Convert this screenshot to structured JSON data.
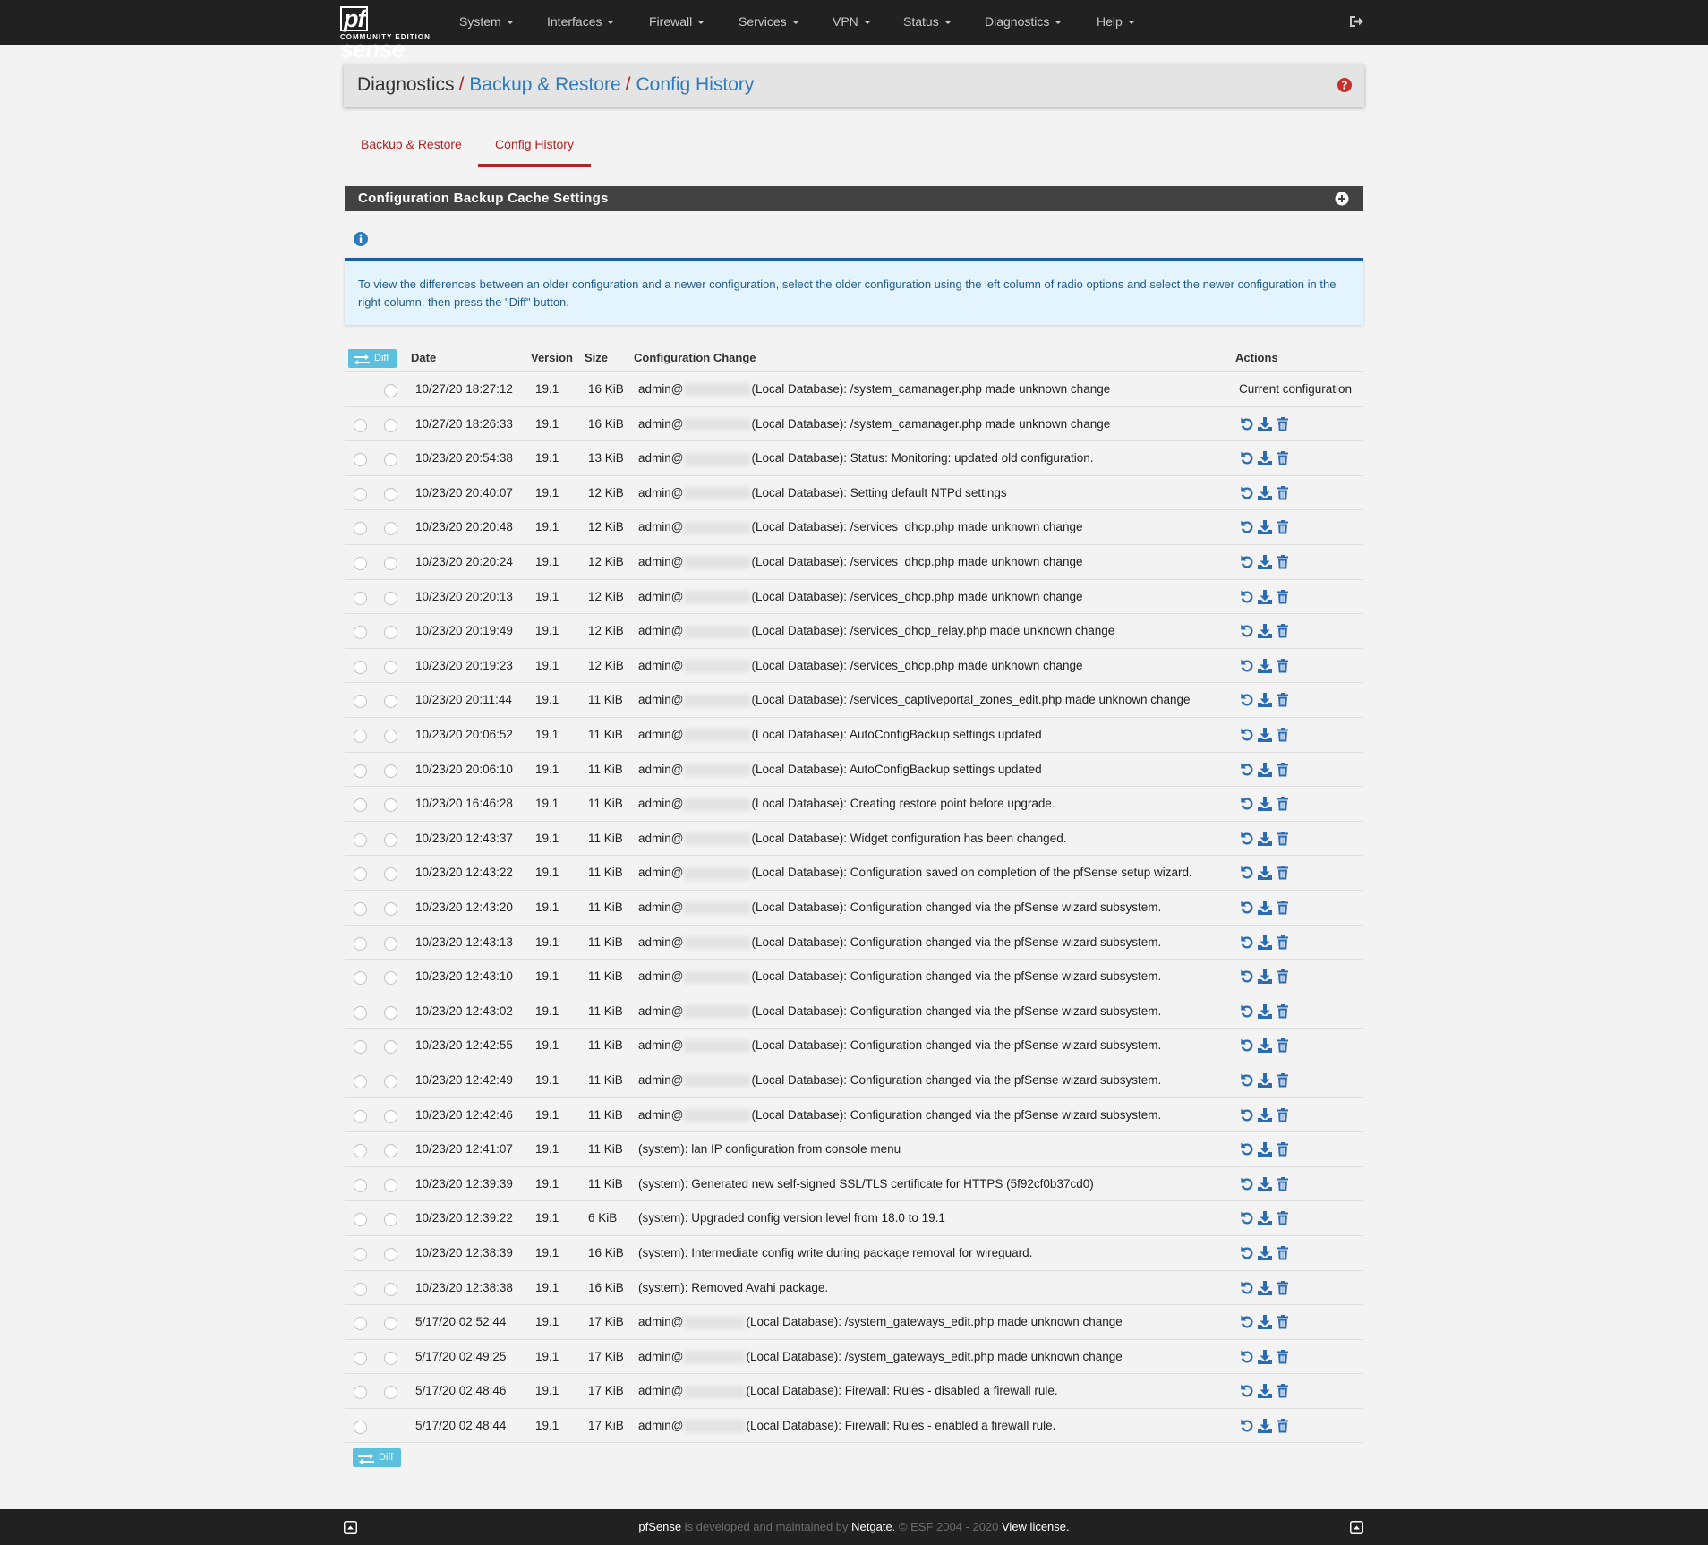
{
  "brand": {
    "name": "pfsense",
    "edition": "COMMUNITY EDITION"
  },
  "nav": {
    "items": [
      {
        "label": "System"
      },
      {
        "label": "Interfaces"
      },
      {
        "label": "Firewall"
      },
      {
        "label": "Services"
      },
      {
        "label": "VPN"
      },
      {
        "label": "Status"
      },
      {
        "label": "Diagnostics"
      },
      {
        "label": "Help"
      }
    ],
    "logout_icon": "sign-out-icon"
  },
  "breadcrumb": {
    "first": "Diagnostics",
    "separator": "/",
    "second": "Backup & Restore",
    "third": "Config History",
    "help_icon": "question-circle-icon"
  },
  "tabs": [
    {
      "label": "Backup & Restore",
      "active": false
    },
    {
      "label": "Config History",
      "active": true
    }
  ],
  "section": {
    "title": "Configuration Backup Cache Settings",
    "toggle_icon": "plus-circle-icon",
    "info_icon": "info-circle-icon"
  },
  "alert": {
    "text": "To view the differences between an older configuration and a newer configuration, select the older configuration using the left column of radio options and select the newer configuration in the right column, then press the \"Diff\" button."
  },
  "table": {
    "diff_label": "Diff",
    "headers": {
      "date": "Date",
      "version": "Version",
      "size": "Size",
      "change": "Configuration Change",
      "actions": "Actions"
    },
    "current_label": "Current configuration",
    "action_icons": [
      "undo-icon",
      "download-icon",
      "trash-icon"
    ],
    "rows": [
      {
        "date": "10/27/20 18:27:12",
        "version": "19.1",
        "size": "16 KiB",
        "user": "admin@",
        "change": "(Local Database): /system_camanager.php made unknown change",
        "current": true,
        "left_radio": false,
        "right_radio": true
      },
      {
        "date": "10/27/20 18:26:33",
        "version": "19.1",
        "size": "16 KiB",
        "user": "admin@",
        "change": "(Local Database): /system_camanager.php made unknown change",
        "current": false,
        "left_radio": true,
        "right_radio": true
      },
      {
        "date": "10/23/20 20:54:38",
        "version": "19.1",
        "size": "13 KiB",
        "user": "admin@",
        "change": "(Local Database): Status: Monitoring: updated old configuration.",
        "current": false,
        "left_radio": true,
        "right_radio": true
      },
      {
        "date": "10/23/20 20:40:07",
        "version": "19.1",
        "size": "12 KiB",
        "user": "admin@",
        "change": "(Local Database): Setting default NTPd settings",
        "current": false,
        "left_radio": true,
        "right_radio": true
      },
      {
        "date": "10/23/20 20:20:48",
        "version": "19.1",
        "size": "12 KiB",
        "user": "admin@",
        "change": "(Local Database): /services_dhcp.php made unknown change",
        "current": false,
        "left_radio": true,
        "right_radio": true
      },
      {
        "date": "10/23/20 20:20:24",
        "version": "19.1",
        "size": "12 KiB",
        "user": "admin@",
        "change": "(Local Database): /services_dhcp.php made unknown change",
        "current": false,
        "left_radio": true,
        "right_radio": true
      },
      {
        "date": "10/23/20 20:20:13",
        "version": "19.1",
        "size": "12 KiB",
        "user": "admin@",
        "change": "(Local Database): /services_dhcp.php made unknown change",
        "current": false,
        "left_radio": true,
        "right_radio": true
      },
      {
        "date": "10/23/20 20:19:49",
        "version": "19.1",
        "size": "12 KiB",
        "user": "admin@",
        "change": "(Local Database): /services_dhcp_relay.php made unknown change",
        "current": false,
        "left_radio": true,
        "right_radio": true
      },
      {
        "date": "10/23/20 20:19:23",
        "version": "19.1",
        "size": "12 KiB",
        "user": "admin@",
        "change": "(Local Database): /services_dhcp.php made unknown change",
        "current": false,
        "left_radio": true,
        "right_radio": true
      },
      {
        "date": "10/23/20 20:11:44",
        "version": "19.1",
        "size": "11 KiB",
        "user": "admin@",
        "change": "(Local Database): /services_captiveportal_zones_edit.php made unknown change",
        "current": false,
        "left_radio": true,
        "right_radio": true
      },
      {
        "date": "10/23/20 20:06:52",
        "version": "19.1",
        "size": "11 KiB",
        "user": "admin@",
        "change": "(Local Database): AutoConfigBackup settings updated",
        "current": false,
        "left_radio": true,
        "right_radio": true
      },
      {
        "date": "10/23/20 20:06:10",
        "version": "19.1",
        "size": "11 KiB",
        "user": "admin@",
        "change": "(Local Database): AutoConfigBackup settings updated",
        "current": false,
        "left_radio": true,
        "right_radio": true
      },
      {
        "date": "10/23/20 16:46:28",
        "version": "19.1",
        "size": "11 KiB",
        "user": "admin@",
        "change": "(Local Database): Creating restore point before upgrade.",
        "current": false,
        "left_radio": true,
        "right_radio": true
      },
      {
        "date": "10/23/20 12:43:37",
        "version": "19.1",
        "size": "11 KiB",
        "user": "admin@",
        "change": "(Local Database): Widget configuration has been changed.",
        "current": false,
        "left_radio": true,
        "right_radio": true
      },
      {
        "date": "10/23/20 12:43:22",
        "version": "19.1",
        "size": "11 KiB",
        "user": "admin@",
        "change": "(Local Database): Configuration saved on completion of the pfSense setup wizard.",
        "current": false,
        "left_radio": true,
        "right_radio": true
      },
      {
        "date": "10/23/20 12:43:20",
        "version": "19.1",
        "size": "11 KiB",
        "user": "admin@",
        "change": "(Local Database): Configuration changed via the pfSense wizard subsystem.",
        "current": false,
        "left_radio": true,
        "right_radio": true
      },
      {
        "date": "10/23/20 12:43:13",
        "version": "19.1",
        "size": "11 KiB",
        "user": "admin@",
        "change": "(Local Database): Configuration changed via the pfSense wizard subsystem.",
        "current": false,
        "left_radio": true,
        "right_radio": true
      },
      {
        "date": "10/23/20 12:43:10",
        "version": "19.1",
        "size": "11 KiB",
        "user": "admin@",
        "change": "(Local Database): Configuration changed via the pfSense wizard subsystem.",
        "current": false,
        "left_radio": true,
        "right_radio": true
      },
      {
        "date": "10/23/20 12:43:02",
        "version": "19.1",
        "size": "11 KiB",
        "user": "admin@",
        "change": "(Local Database): Configuration changed via the pfSense wizard subsystem.",
        "current": false,
        "left_radio": true,
        "right_radio": true
      },
      {
        "date": "10/23/20 12:42:55",
        "version": "19.1",
        "size": "11 KiB",
        "user": "admin@",
        "change": "(Local Database): Configuration changed via the pfSense wizard subsystem.",
        "current": false,
        "left_radio": true,
        "right_radio": true
      },
      {
        "date": "10/23/20 12:42:49",
        "version": "19.1",
        "size": "11 KiB",
        "user": "admin@",
        "change": "(Local Database): Configuration changed via the pfSense wizard subsystem.",
        "current": false,
        "left_radio": true,
        "right_radio": true
      },
      {
        "date": "10/23/20 12:42:46",
        "version": "19.1",
        "size": "11 KiB",
        "user": "admin@",
        "change": "(Local Database): Configuration changed via the pfSense wizard subsystem.",
        "current": false,
        "left_radio": true,
        "right_radio": true
      },
      {
        "date": "10/23/20 12:41:07",
        "version": "19.1",
        "size": "11 KiB",
        "user": "",
        "change": "(system): lan IP configuration from console menu",
        "current": false,
        "left_radio": true,
        "right_radio": true
      },
      {
        "date": "10/23/20 12:39:39",
        "version": "19.1",
        "size": "11 KiB",
        "user": "",
        "change": "(system): Generated new self-signed SSL/TLS certificate for HTTPS (5f92cf0b37cd0)",
        "current": false,
        "left_radio": true,
        "right_radio": true
      },
      {
        "date": "10/23/20 12:39:22",
        "version": "19.1",
        "size": "6 KiB",
        "user": "",
        "change": "(system): Upgraded config version level from 18.0 to 19.1",
        "current": false,
        "left_radio": true,
        "right_radio": true
      },
      {
        "date": "10/23/20 12:38:39",
        "version": "19.1",
        "size": "16 KiB",
        "user": "",
        "change": "(system): Intermediate config write during package removal for wireguard.",
        "current": false,
        "left_radio": true,
        "right_radio": true
      },
      {
        "date": "10/23/20 12:38:38",
        "version": "19.1",
        "size": "16 KiB",
        "user": "",
        "change": "(system): Removed Avahi package.",
        "current": false,
        "left_radio": true,
        "right_radio": true
      },
      {
        "date": "5/17/20 02:52:44",
        "version": "19.1",
        "size": "17 KiB",
        "user": "admin@",
        "ip_short": true,
        "change": "(Local Database): /system_gateways_edit.php made unknown change",
        "current": false,
        "left_radio": true,
        "right_radio": true
      },
      {
        "date": "5/17/20 02:49:25",
        "version": "19.1",
        "size": "17 KiB",
        "user": "admin@",
        "ip_short": true,
        "change": "(Local Database): /system_gateways_edit.php made unknown change",
        "current": false,
        "left_radio": true,
        "right_radio": true
      },
      {
        "date": "5/17/20 02:48:46",
        "version": "19.1",
        "size": "17 KiB",
        "user": "admin@",
        "ip_short": true,
        "change": "(Local Database): Firewall: Rules - disabled a firewall rule.",
        "current": false,
        "left_radio": true,
        "right_radio": true
      },
      {
        "date": "5/17/20 02:48:44",
        "version": "19.1",
        "size": "17 KiB",
        "user": "admin@",
        "ip_short": true,
        "change": "(Local Database): Firewall: Rules - enabled a firewall rule.",
        "current": false,
        "left_radio": true,
        "right_radio": false
      }
    ]
  },
  "footer": {
    "brand": "pfSense",
    "text1": " is developed and maintained by ",
    "company": "Netgate.",
    "text2": " © ESF 2004 - 2020 ",
    "license": "View license.",
    "left_icon": "caret-square-up-icon",
    "right_icon": "caret-square-up-icon"
  },
  "colors": {
    "navbar": "#212121",
    "accent_red": "#b02424",
    "link_blue": "#2c7bbf",
    "info_blue": "#1d5ea3",
    "icon_blue": "#2b6cb0",
    "diff_button": "#5bc0de"
  }
}
